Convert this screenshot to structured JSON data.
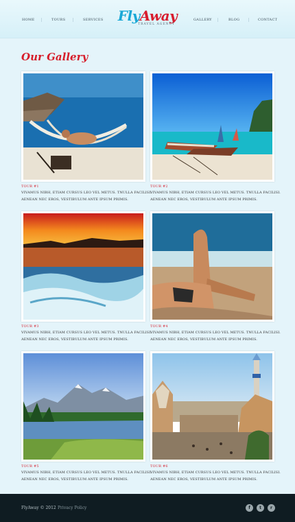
{
  "nav": {
    "home": "HOME",
    "tours": "TOURS",
    "services": "SERVICES",
    "gallery": "GALLERY",
    "blog": "BLOG",
    "contact": "CONTACT"
  },
  "logo": {
    "fly": "Fly",
    "away": "Away",
    "tagline": "TRAVEL AGENCY"
  },
  "page": {
    "title": "Our Gallery"
  },
  "gallery": [
    {
      "title": "TOUR #1",
      "text": "VIVAMUS NIBH, ETIAM CURSUS LEO VEL METUS. TNULLA FACILISI. AENEAN NEC EROS, VESTIBULUM ANTE IPSUM PRIMIS."
    },
    {
      "title": "TOUR #2",
      "text": "VIVAMUS NIBH, ETIAM CURSUS LEO VEL METUS. TNULLA FACILISI. AENEAN NEC EROS, VESTIBULUM ANTE IPSUM PRIMIS."
    },
    {
      "title": "TOUR #3",
      "text": "VIVAMUS NIBH, ETIAM CURSUS LEO VEL METUS. TNULLA FACILISI. AENEAN NEC EROS, VESTIBULUM ANTE IPSUM PRIMIS."
    },
    {
      "title": "TOUR #4",
      "text": "VIVAMUS NIBH, ETIAM CURSUS LEO VEL METUS. TNULLA FACILISI. AENEAN NEC EROS, VESTIBULUM ANTE IPSUM PRIMIS."
    },
    {
      "title": "TOUR #5",
      "text": "VIVAMUS NIBH, ETIAM CURSUS LEO VEL METUS. TNULLA FACILISI. AENEAN NEC EROS, VESTIBULUM ANTE IPSUM PRIMIS."
    },
    {
      "title": "TOUR #6",
      "text": "VIVAMUS NIBH, ETIAM CURSUS LEO VEL METUS. TNULLA FACILISI. AENEAN NEC EROS, VESTIBULUM ANTE IPSUM PRIMIS."
    }
  ],
  "footer": {
    "brand": "FlyAway © 2012",
    "privacy": "Privacy Policy",
    "social": {
      "facebook": "f",
      "twitter": "t",
      "rss": "r"
    }
  },
  "colors": {
    "accent_red": "#d61e2b",
    "accent_blue": "#19a8d6",
    "background": "#e4f4fa",
    "footer": "#0f1c22"
  },
  "icons": [
    "facebook-icon",
    "twitter-icon",
    "rss-icon"
  ]
}
